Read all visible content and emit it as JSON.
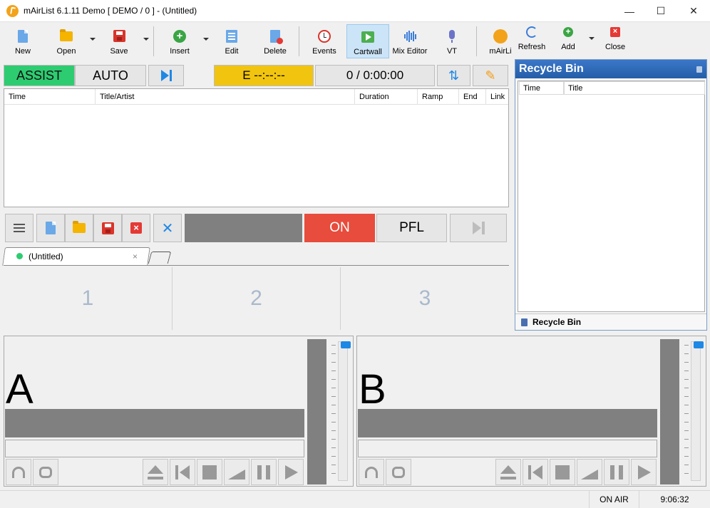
{
  "window": {
    "title": "mAirList 6.1.11 Demo [ DEMO / 0 ] - (Untitled)",
    "minimize": "—",
    "maximize": "☐",
    "close": "✕"
  },
  "toolbar": {
    "new": "New",
    "open": "Open",
    "save": "Save",
    "insert": "Insert",
    "edit": "Edit",
    "delete": "Delete",
    "events": "Events",
    "cartwall": "Cartwall",
    "mix_editor": "Mix Editor",
    "vt": "VT",
    "mairlist": "mAirLi",
    "refresh": "Refresh",
    "add": "Add",
    "close": "Close"
  },
  "playlist": {
    "assist": "ASSIST",
    "auto": "AUTO",
    "eta": "E   --:--:--",
    "counter": "0 / 0:00:00",
    "sort_icon": "⇅",
    "pencil_icon": "✎",
    "columns": [
      "Time",
      "Title/Artist",
      "Duration",
      "Ramp",
      "End",
      "Link"
    ]
  },
  "player_bar": {
    "on": "ON",
    "pfl": "PFL"
  },
  "cartwall": {
    "tab_label": "(Untitled)",
    "tab_close": "×",
    "slots": [
      "1",
      "2",
      "3"
    ]
  },
  "recycle_bin": {
    "title": "Recycle Bin",
    "columns": [
      "Time",
      "Title"
    ],
    "footer": "Recycle Bin"
  },
  "players": [
    {
      "letter": "A"
    },
    {
      "letter": "B"
    }
  ],
  "status": {
    "on_air": "ON AIR",
    "clock": "9:06:32"
  },
  "colors": {
    "assist": "#2ecc71",
    "eta": "#f1c40f",
    "on_air": "#e74c3c",
    "accent": "#1e88e5"
  }
}
